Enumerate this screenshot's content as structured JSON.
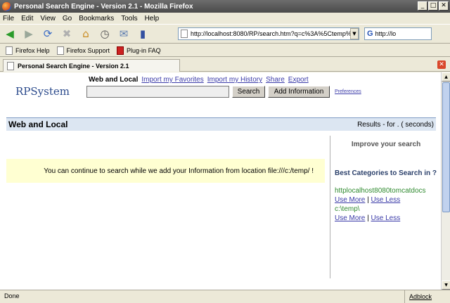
{
  "window": {
    "title": "Personal Search Engine - Version 2.1 - Mozilla Firefox"
  },
  "menu": [
    "File",
    "Edit",
    "View",
    "Go",
    "Bookmarks",
    "Tools",
    "Help"
  ],
  "address": {
    "url": "http://localhost:8080/RP/search.htm?q=c%3A%5Ctemp%5C&"
  },
  "search_bar": {
    "value": "http://lo"
  },
  "bookmarks": [
    "Firefox Help",
    "Firefox Support",
    "Plug-in FAQ"
  ],
  "tab": {
    "title": "Personal Search Engine - Version 2.1"
  },
  "page": {
    "logo": "RPSystem",
    "tabs": {
      "active": "Web and Local",
      "import_favorites": "Import my Favorites",
      "import_history": "Import my History",
      "share": "Share",
      "export": "Export"
    },
    "search_value": "",
    "search_button": "Search",
    "add_info_button": "Add Information",
    "preferences_link": "Preferences",
    "section_title": "Web and Local",
    "results_text": "Results - for . ( seconds)",
    "notice": "You can continue to search while we add your Information from location file:///c:/temp/ !",
    "improve": "Improve your search",
    "best_categories": "Best Categories to Search in ?",
    "categories": [
      {
        "name": "httplocalhost8080tomcatdocs",
        "more": "Use More",
        "sep": "|",
        "less": "Use Less"
      },
      {
        "name": "c:\\temp\\",
        "more": "Use More",
        "sep": "|",
        "less": "Use Less"
      }
    ]
  },
  "status": {
    "text": "Done",
    "adblock": "Adblock"
  },
  "colors": {
    "link": "#3a3aa8",
    "category": "#2f8a2f",
    "notice_bg": "#ffffd2",
    "header_bg": "#dce6f2"
  }
}
